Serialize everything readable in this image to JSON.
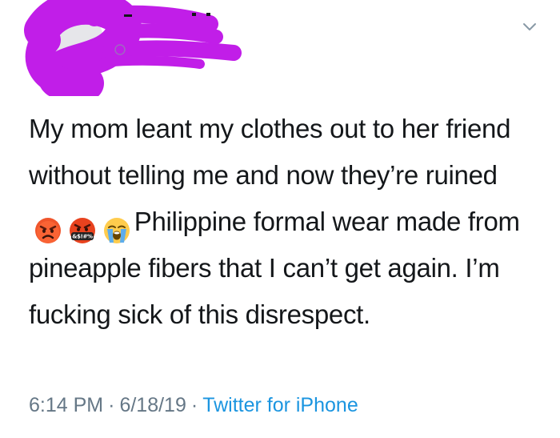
{
  "tweet": {
    "body_part1": "My mom leant my clothes out to her friend without telling me and now they’re ruined",
    "body_part2": "Philippine formal wear made from pineapple fibers that I can’t get again. I’m fucking sick of this disrespect.",
    "emojis": [
      "angry-face",
      "face-with-symbols-on-mouth",
      "loudly-crying-face"
    ],
    "emoji_symbols_text": "&$!#%",
    "time": "6:14 PM",
    "date": "6/18/19",
    "separator": "·",
    "source": "Twitter for iPhone"
  },
  "colors": {
    "text": "#14171a",
    "meta": "#657786",
    "link": "#1b95e0",
    "redaction": "#c11ee8"
  }
}
